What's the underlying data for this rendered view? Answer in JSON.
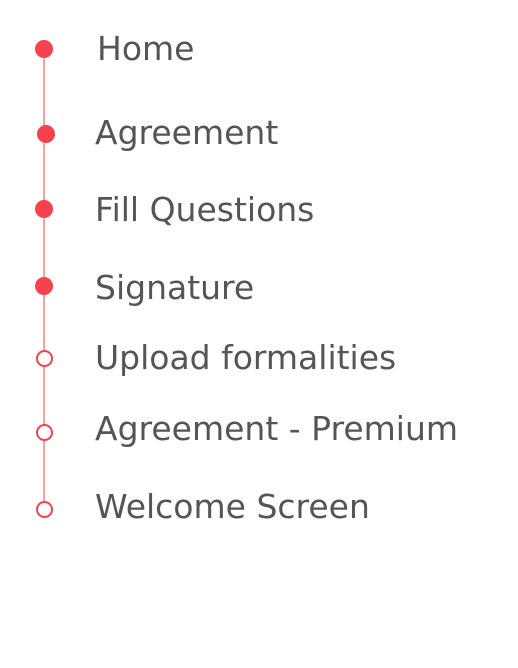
{
  "stepper": {
    "accent_color": "#f5424d",
    "steps": [
      {
        "label": "Home",
        "status": "complete",
        "icon": "filled-dot-icon"
      },
      {
        "label": "Agreement",
        "status": "complete",
        "icon": "filled-dot-icon"
      },
      {
        "label": "Fill Questions",
        "status": "complete",
        "icon": "filled-dot-icon"
      },
      {
        "label": "Signature",
        "status": "complete",
        "icon": "filled-dot-icon"
      },
      {
        "label": "Upload formalities",
        "status": "pending",
        "icon": "hollow-dot-icon"
      },
      {
        "label": "Agreement - Premium",
        "status": "pending",
        "icon": "hollow-dot-icon"
      },
      {
        "label": "Welcome Screen",
        "status": "pending",
        "icon": "hollow-dot-icon"
      }
    ]
  }
}
